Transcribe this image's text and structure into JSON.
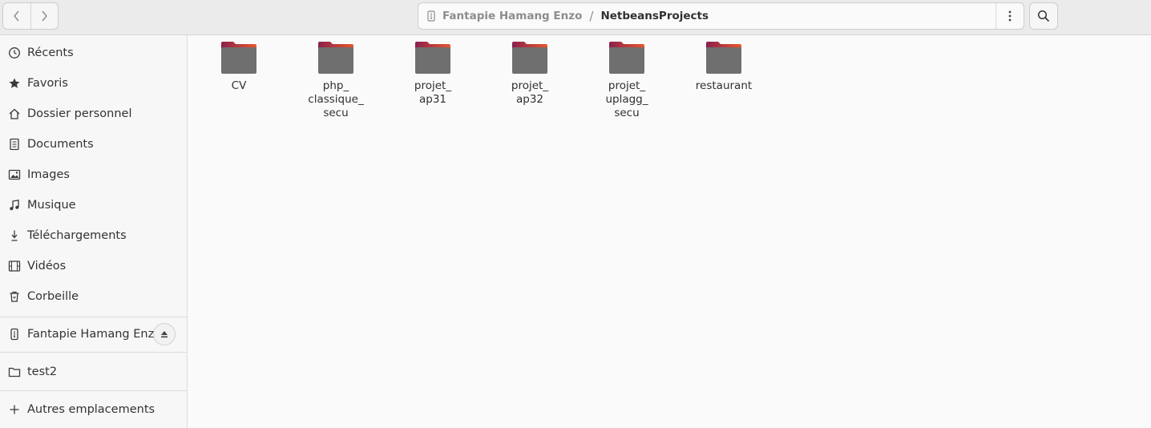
{
  "header": {
    "back_icon": "chevron-left-icon",
    "forward_icon": "chevron-right-icon",
    "path": {
      "drive_icon": "usb-drive-icon",
      "parent": "Fantapie Hamang Enzo",
      "separator": "/",
      "current": "NetbeansProjects",
      "menu_icon": "vertical-dots-icon"
    },
    "search_icon": "search-icon"
  },
  "sidebar": {
    "items": [
      {
        "label": "Récents",
        "icon": "clock-icon"
      },
      {
        "label": "Favoris",
        "icon": "star-icon"
      },
      {
        "label": "Dossier personnel",
        "icon": "home-icon"
      },
      {
        "label": "Documents",
        "icon": "document-icon"
      },
      {
        "label": "Images",
        "icon": "image-icon"
      },
      {
        "label": "Musique",
        "icon": "music-icon"
      },
      {
        "label": "Téléchargements",
        "icon": "download-icon"
      },
      {
        "label": "Vidéos",
        "icon": "video-icon"
      },
      {
        "label": "Corbeille",
        "icon": "trash-icon"
      }
    ],
    "devices": [
      {
        "label": "Fantapie Hamang Enzo",
        "icon": "usb-drive-icon",
        "eject_icon": "eject-icon"
      }
    ],
    "bookmarks": [
      {
        "label": "test2",
        "icon": "folder-icon"
      }
    ],
    "other_locations": {
      "label": "Autres emplacements",
      "icon": "plus-icon"
    }
  },
  "folders": [
    {
      "name": "CV"
    },
    {
      "name": "php_\nclassique_\nsecu"
    },
    {
      "name": "projet_\nap31"
    },
    {
      "name": "projet_\nap32"
    },
    {
      "name": "projet_\nuplagg_\nsecu"
    },
    {
      "name": "restaurant"
    }
  ],
  "colors": {
    "folder_body": "#6f6f6f",
    "folder_tab_start": "#8a1f4e",
    "folder_tab_end": "#e9572a"
  }
}
